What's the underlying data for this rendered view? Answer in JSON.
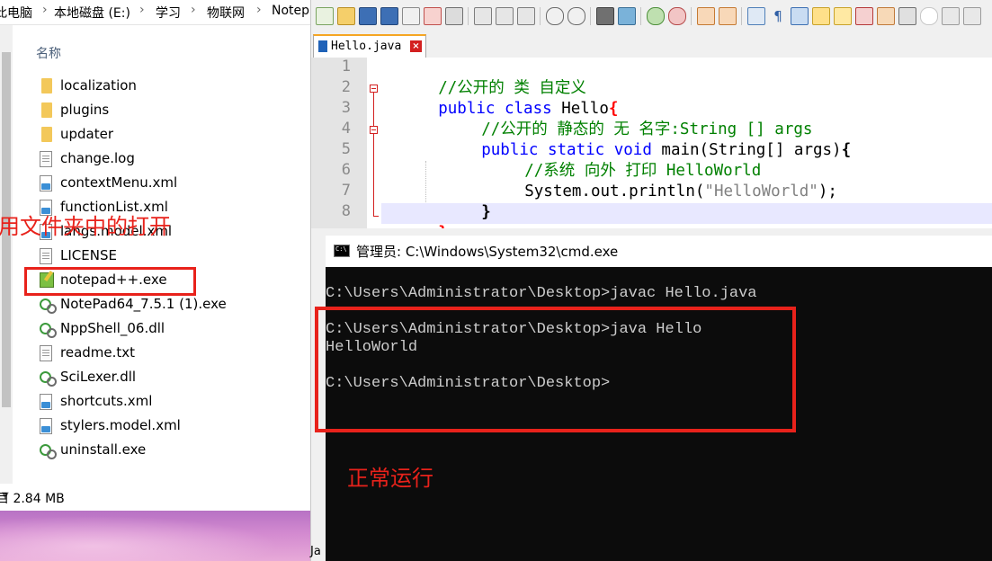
{
  "explorer": {
    "breadcrumb": [
      "此电脑",
      "本地磁盘 (E:)",
      "学习",
      "物联网",
      "Notep"
    ],
    "column_header": "名称",
    "files": [
      {
        "name": "localization",
        "icon": "folder-icon"
      },
      {
        "name": "plugins",
        "icon": "folder-icon"
      },
      {
        "name": "updater",
        "icon": "folder-icon"
      },
      {
        "name": "change.log",
        "icon": "text-file-icon"
      },
      {
        "name": "contextMenu.xml",
        "icon": "xml-file-icon"
      },
      {
        "name": "functionList.xml",
        "icon": "xml-file-icon"
      },
      {
        "name": "langs.model.xml",
        "icon": "xml-file-icon"
      },
      {
        "name": "LICENSE",
        "icon": "text-file-icon"
      },
      {
        "name": "notepad++.exe",
        "icon": "notepad-plus-plus-icon"
      },
      {
        "name": "NotePad64_7.5.1 (1).exe",
        "icon": "exe-icon"
      },
      {
        "name": "NppShell_06.dll",
        "icon": "dll-icon"
      },
      {
        "name": "readme.txt",
        "icon": "text-file-icon"
      },
      {
        "name": "SciLexer.dll",
        "icon": "dll-icon"
      },
      {
        "name": "shortcuts.xml",
        "icon": "xml-file-icon"
      },
      {
        "name": "stylers.model.xml",
        "icon": "xml-file-icon"
      },
      {
        "name": "uninstall.exe",
        "icon": "exe-icon"
      }
    ],
    "status": "目 2.84 MB"
  },
  "annotations": {
    "open_in_folder": "用文件夹中的打开",
    "runs_normally": "正常运行"
  },
  "notepad": {
    "tab_label": "Hello.java",
    "line_numbers": [
      "1",
      "2",
      "3",
      "4",
      "5",
      "6",
      "7",
      "8"
    ],
    "code": {
      "l1_comment": "//公开的 类 自定义",
      "l2_kw": "public class",
      "l2_ident": " Hello",
      "l2_brace": "{",
      "l3_comment": "//公开的 静态的 无 名字:String [] args",
      "l4_kw": "public static void",
      "l4_ident": " main(String[] args)",
      "l4_brace": "{",
      "l5_comment": "//系统 向外 打印 HelloWorld",
      "l6_pre": "System.out.println(",
      "l6_str": "\"HelloWorld\"",
      "l6_post": ");",
      "l7_brace": "}",
      "l8_brace": "}"
    },
    "status_fragment": "Ja"
  },
  "cmd": {
    "title": "管理员: C:\\Windows\\System32\\cmd.exe",
    "lines": [
      "C:\\Users\\Administrator\\Desktop>javac Hello.java",
      "",
      "C:\\Users\\Administrator\\Desktop>java Hello",
      "HelloWorld",
      "",
      "C:\\Users\\Administrator\\Desktop>"
    ]
  },
  "colors": {
    "annotation_red": "#e8221b",
    "comment_green": "#008000",
    "keyword_blue": "#0000ff",
    "cmd_background": "#0c0c0c"
  }
}
